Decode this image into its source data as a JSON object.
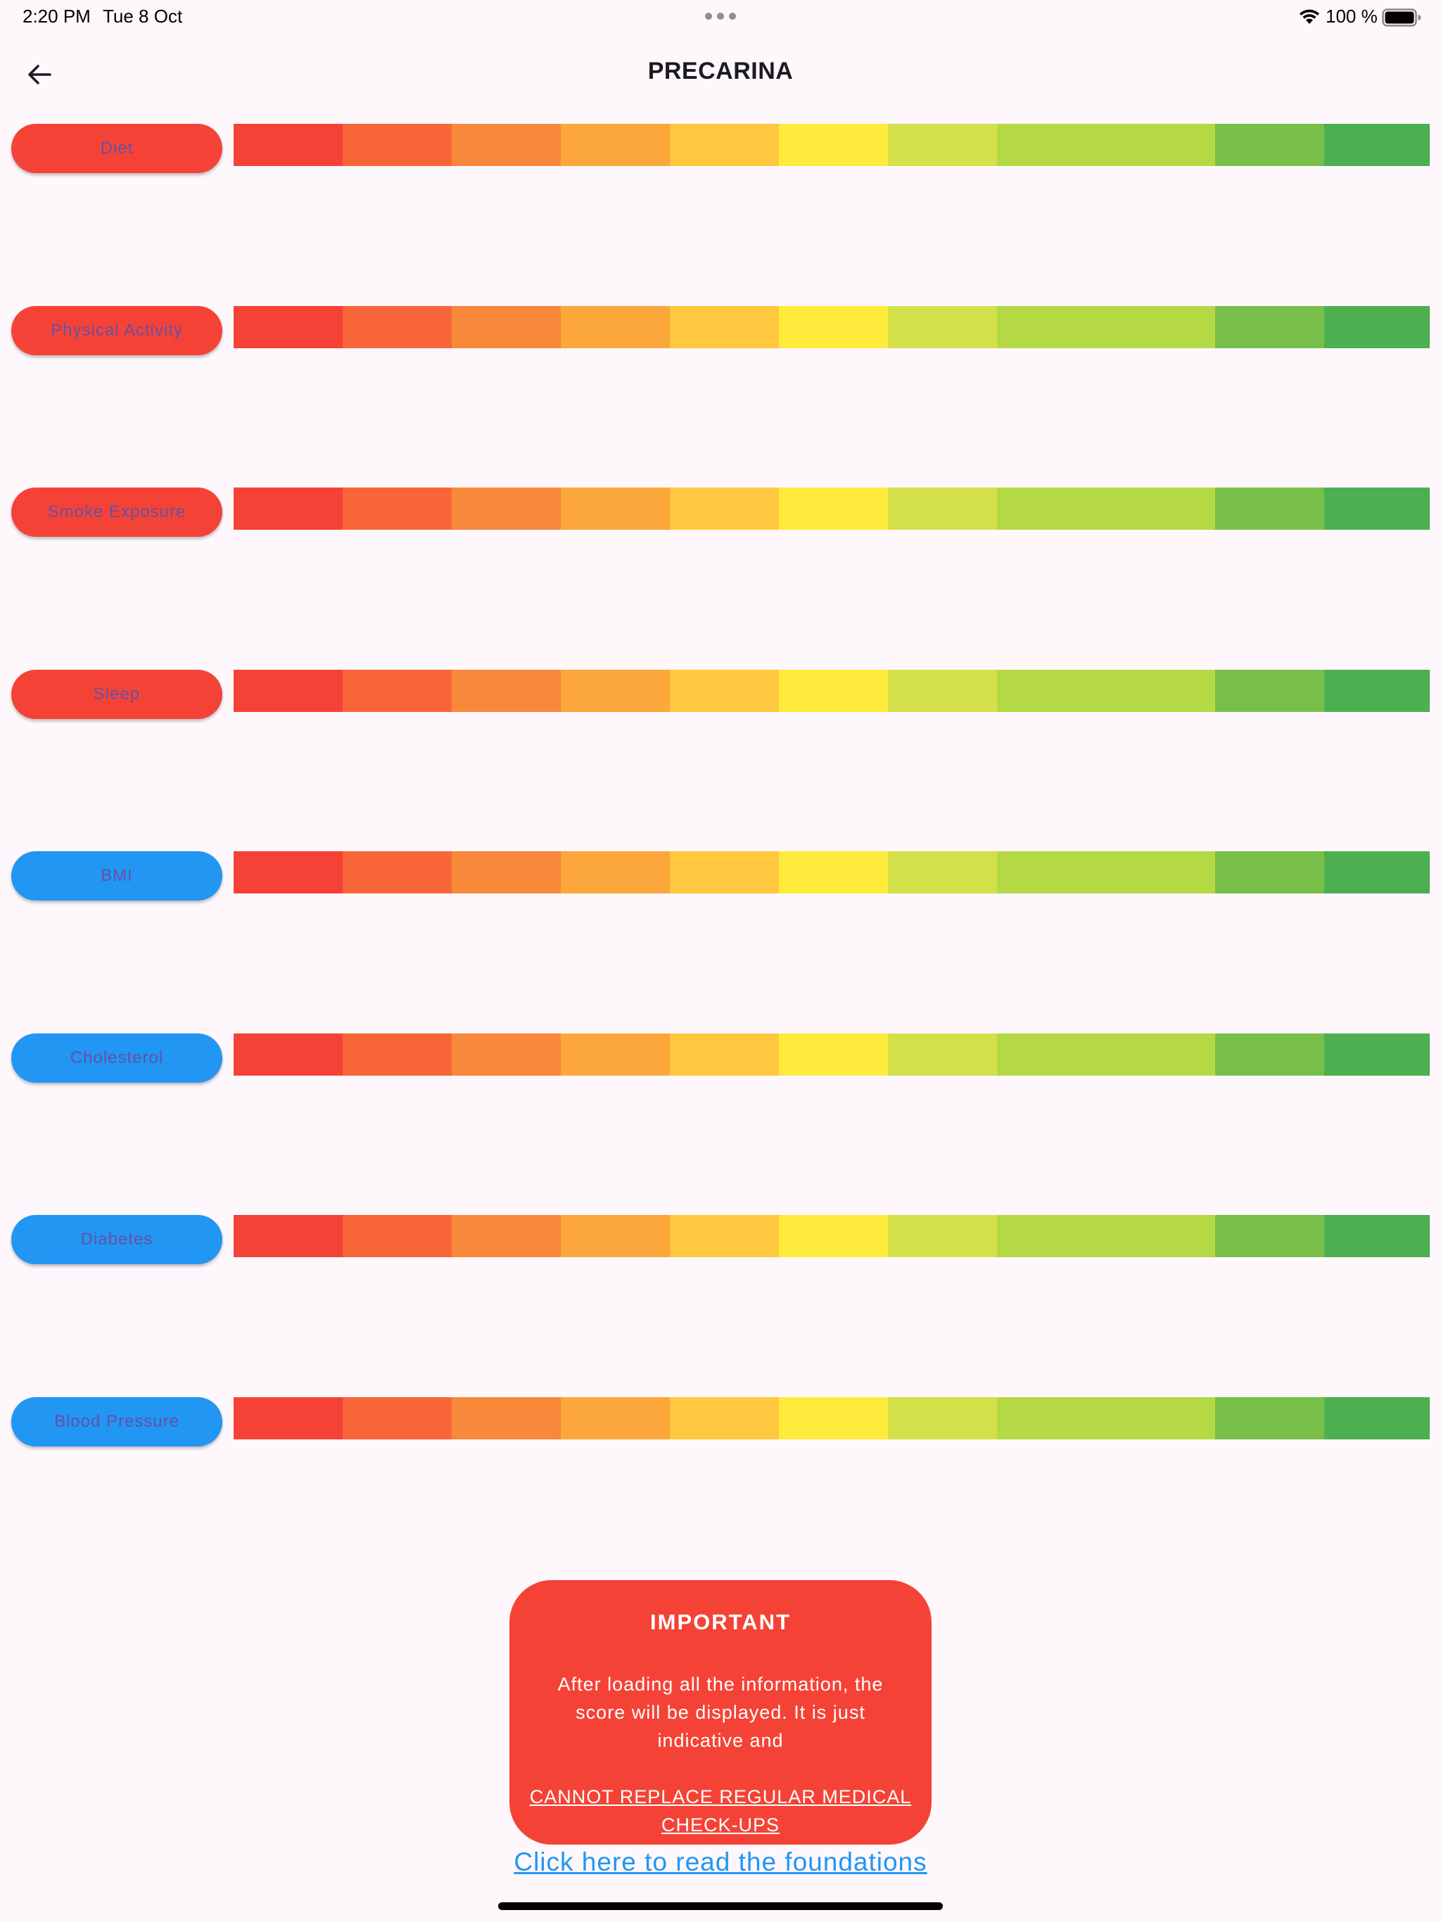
{
  "status_bar": {
    "time": "2:20 PM",
    "date": "Tue 8 Oct",
    "battery": "100 %",
    "icons": [
      "more-dots-icon",
      "wifi-icon",
      "battery-icon"
    ]
  },
  "app_bar": {
    "title": "PRECARINA",
    "back_icon": "arrow-back-icon"
  },
  "colors": {
    "lifestyle_button": "#f44336",
    "clinical_button": "#2196f3",
    "button_text": "#6750a4",
    "background": "#fef7fc",
    "important_box": "#f44336",
    "link": "#2196f3"
  },
  "scale_colors": [
    "#f44336",
    "#f76538",
    "#f8883a",
    "#fca73c",
    "#ffc83e",
    "#ffeb3c",
    "#d4e04a",
    "#b5d944",
    "#b5d944",
    "#78bf4a",
    "#4caf50"
  ],
  "risk_factors": [
    {
      "label": "Diet",
      "group": "lifestyle"
    },
    {
      "label": "Physical Activity",
      "group": "lifestyle"
    },
    {
      "label": "Smoke Exposure",
      "group": "lifestyle"
    },
    {
      "label": "Sleep",
      "group": "lifestyle"
    },
    {
      "label": "BMI",
      "group": "clinical"
    },
    {
      "label": "Cholesterol",
      "group": "clinical"
    },
    {
      "label": "Diabetes",
      "group": "clinical"
    },
    {
      "label": "Blood Pressure",
      "group": "clinical"
    }
  ],
  "important": {
    "title": "IMPORTANT",
    "body": "After loading all the information, the score will be displayed. It is just indicative and",
    "warning": "CANNOT REPLACE REGULAR MEDICAL CHECK-UPS"
  },
  "foundations_link": "Click here to read the foundations"
}
